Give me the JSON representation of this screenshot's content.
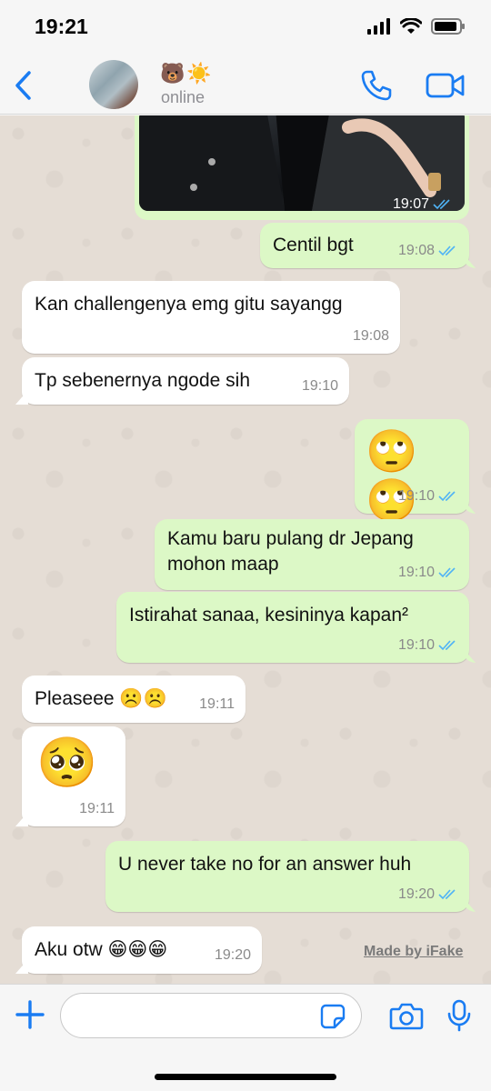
{
  "status_bar": {
    "time": "19:21"
  },
  "header": {
    "contact_name": "🐻☀️",
    "contact_status": "online"
  },
  "messages": [
    {
      "side": "out",
      "kind": "photo",
      "time": "19:07"
    },
    {
      "side": "out",
      "text": "Centil bgt",
      "time": "19:08"
    },
    {
      "side": "in",
      "text": "Kan challengenya emg gitu sayangg",
      "time": "19:08"
    },
    {
      "side": "in",
      "text": "Tp sebenernya ngode sih",
      "time": "19:10"
    },
    {
      "side": "out",
      "text": "🙄🙄",
      "time": "19:10"
    },
    {
      "side": "out",
      "text": "Kamu baru pulang dr Jepang\nmohon maap",
      "time": "19:10"
    },
    {
      "side": "out",
      "text": "Istirahat sanaa, kesininya kapan²",
      "time": "19:10"
    },
    {
      "side": "in",
      "text": "Pleaseee ☹️☹️",
      "time": "19:11"
    },
    {
      "side": "in",
      "text": "🥺",
      "time": "19:11"
    },
    {
      "side": "out",
      "text": "U never take no for an answer huh",
      "time": "19:20"
    },
    {
      "side": "in",
      "text": "Aku otw 😁😁😁",
      "time": "19:20"
    }
  ],
  "watermark": "Made by iFake",
  "colors": {
    "accent": "#1a7cf2",
    "outgoing_bubble": "#dcf8c6",
    "incoming_bubble": "#ffffff",
    "read_ticks": "#4fb3f6"
  }
}
